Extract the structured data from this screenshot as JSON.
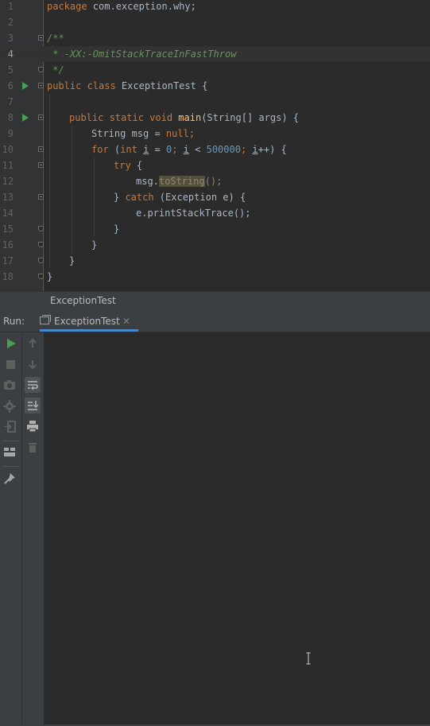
{
  "editor": {
    "lines": [
      {
        "n": "1"
      },
      {
        "n": "2"
      },
      {
        "n": "3"
      },
      {
        "n": "4"
      },
      {
        "n": "5"
      },
      {
        "n": "6"
      },
      {
        "n": "7"
      },
      {
        "n": "8"
      },
      {
        "n": "9"
      },
      {
        "n": "10"
      },
      {
        "n": "11"
      },
      {
        "n": "12"
      },
      {
        "n": "13"
      },
      {
        "n": "14"
      },
      {
        "n": "15"
      },
      {
        "n": "16"
      },
      {
        "n": "17"
      },
      {
        "n": "18"
      }
    ],
    "code": {
      "l1_kw": "package",
      "l1_rest": " com.exception.why;",
      "l3": "/**",
      "l4": " * -XX:-OmitStackTraceInFastThrow",
      "l5": " */",
      "l6_kw": "public class",
      "l6_rest": " ExceptionTest {",
      "l8_kw": "public static void",
      "l8_fn": "main",
      "l8_rest": "(String[] args) {",
      "l9_a": "String msg = ",
      "l9_kw": "null",
      "l9_b": ";",
      "l10_kw1": "for",
      "l10_a": " (",
      "l10_kw2": "int",
      "l10_b": " ",
      "l10_i1": "i",
      "l10_c": " = ",
      "l10_n0": "0",
      "l10_d": "; ",
      "l10_i2": "i",
      "l10_e": " < ",
      "l10_n1": "500000",
      "l10_f": "; ",
      "l10_i3": "i",
      "l10_g": "++) {",
      "l11_kw": "try",
      "l11_rest": " {",
      "l12_a": "msg.",
      "l12_hl": "toString",
      "l12_b": "();",
      "l13_a": "} ",
      "l13_kw": "catch",
      "l13_b": " (Exception e) {",
      "l14": "e.printStackTrace();",
      "l15": "}",
      "l16": "}",
      "l17": "}",
      "l18": "}"
    },
    "current_line": 4
  },
  "breadcrumb": {
    "class_name": "ExceptionTest"
  },
  "run_panel": {
    "label": "Run:",
    "tab_label": "ExceptionTest",
    "tab_close": "✕",
    "console_output": ""
  },
  "colors": {
    "editor_bg": "#2b2b2b",
    "keyword": "#cc7832",
    "number": "#6897bb",
    "doc_comment": "#629755",
    "method": "#ffc66d",
    "run_green": "#499c54",
    "tab_underline": "#4a88c7"
  },
  "toolbar_left": [
    {
      "icon": "run-icon"
    },
    {
      "icon": "stop-icon"
    },
    {
      "icon": "camera-icon"
    },
    {
      "icon": "settings-icon"
    },
    {
      "icon": "exit-icon"
    },
    {
      "icon": "layout-icon"
    },
    {
      "icon": "pin-icon"
    }
  ],
  "toolbar_right": [
    {
      "icon": "arrow-up-icon"
    },
    {
      "icon": "arrow-down-icon"
    },
    {
      "icon": "soft-wrap-icon"
    },
    {
      "icon": "scroll-to-end-icon"
    },
    {
      "icon": "print-icon"
    },
    {
      "icon": "trash-icon"
    }
  ]
}
